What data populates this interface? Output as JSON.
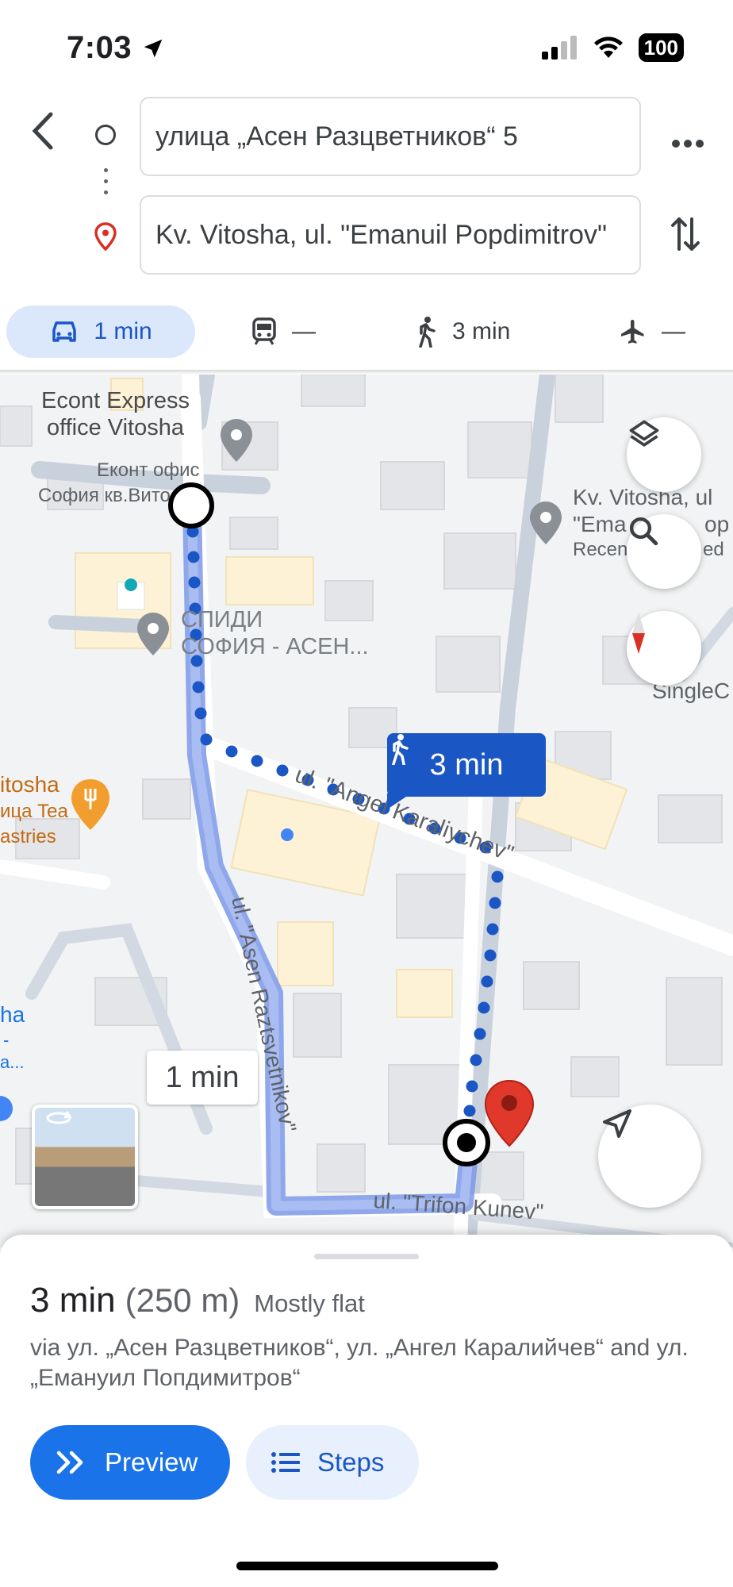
{
  "status": {
    "time": "7:03",
    "battery": "100"
  },
  "search": {
    "origin": "улица „Асен Разцветников“ 5",
    "destination": "Kv. Vitosha, ul. \"Emanuil Popdimitrov\""
  },
  "modes": {
    "car": "1 min",
    "transit": "—",
    "walk": "3 min",
    "flight": "—"
  },
  "map": {
    "poi_econt_line1": "Econt Express",
    "poi_econt_line2": "office Vitosha",
    "poi_econt_bg1": "Еконт офис",
    "poi_econt_bg2": "София кв.Вито",
    "poi_speedy_line1": "СПИДИ",
    "poi_speedy_line2": "СОФИЯ - АСЕН...",
    "dest_label_line1": "Kv. Vitosha, ul",
    "dest_label_line2": "\"Ema",
    "dest_label_line2b": "ор",
    "dest_label_line3": "Recen",
    "dest_label_line3b": "ed",
    "single_label": "SingleC",
    "cafe_line1": "itosha",
    "cafe_line2": "ица Tea",
    "cafe_line3": "astries",
    "left_edge_1": "ha",
    "left_edge_2": "-",
    "left_edge_3": "a...",
    "street_angel": "ul. \"Angel Karaliychev\"",
    "street_asen": "ul. \"Asen Raztsvetnikov\"",
    "street_trifon": "ul. \"Trifon Kunev\"",
    "walk_bubble": "3 min",
    "car_bubble": "1 min"
  },
  "sheet": {
    "time": "3 min",
    "distance": "(250 m)",
    "terrain": "Mostly flat",
    "via": "via ул. „Асен Разцветников“, ул. „Ангел Каралийчев“ and ул. „Емануил Попдимитров“",
    "preview_label": "Preview",
    "steps_label": "Steps"
  },
  "colors": {
    "accent": "#1a73e8",
    "route_walk": "#1a56c4",
    "route_car_fill": "#8fa9ec",
    "pin_red": "#d93025"
  }
}
